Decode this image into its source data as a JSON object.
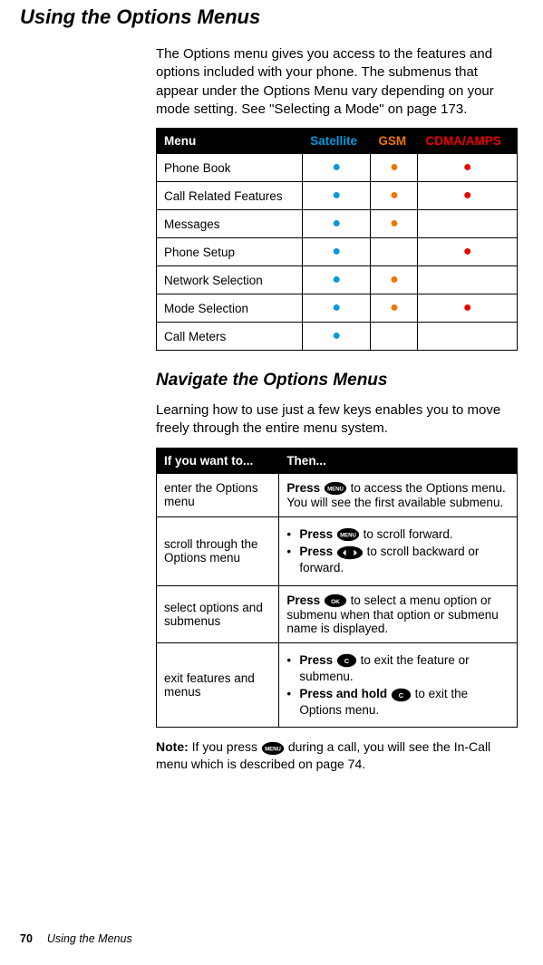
{
  "title": "Using the Options Menus",
  "intro": "The Options menu gives you access to the features and options included with your phone. The submenus that appear under the Options Menu vary depending on your mode setting. See \"Selecting a Mode\" on page 173.",
  "modes_table": {
    "head_menu": "Menu",
    "head_satellite": "Satellite",
    "head_gsm": "GSM",
    "head_cdma": "CDMA/AMPS",
    "rows": [
      {
        "label": "Phone Book",
        "sat": true,
        "gsm": true,
        "cdma": true
      },
      {
        "label": "Call Related Features",
        "sat": true,
        "gsm": true,
        "cdma": true
      },
      {
        "label": "Messages",
        "sat": true,
        "gsm": true,
        "cdma": false
      },
      {
        "label": "Phone Setup",
        "sat": true,
        "gsm": false,
        "cdma": true
      },
      {
        "label": "Network Selection",
        "sat": true,
        "gsm": true,
        "cdma": false
      },
      {
        "label": "Mode Selection",
        "sat": true,
        "gsm": true,
        "cdma": true
      },
      {
        "label": "Call Meters",
        "sat": true,
        "gsm": false,
        "cdma": false
      }
    ]
  },
  "navigate_heading": "Navigate the Options Menus",
  "navigate_para": "Learning how to use just a few keys enables you to move freely through the entire menu system.",
  "keys_table": {
    "head_if": "If you want to...",
    "head_then": "Then...",
    "rows": {
      "enter": {
        "if": "enter the Options menu",
        "then_pre": "Press ",
        "then_post": " to access the Options menu. You will see the first available submenu."
      },
      "scroll": {
        "if": "scroll through the Options menu",
        "b1_pre": "Press ",
        "b1_post": " to scroll forward.",
        "b2_pre": "Press ",
        "b2_post": " to scroll backward or forward."
      },
      "select": {
        "if": "select options and submenus",
        "then_pre": "Press ",
        "then_post": " to select a menu option or submenu when that option or submenu name is displayed."
      },
      "exit": {
        "if": "exit features and menus",
        "b1_pre": "Press ",
        "b1_post": " to exit the feature or submenu.",
        "b2_pre": "Press and hold ",
        "b2_post": " to exit the Options menu."
      }
    }
  },
  "note_bold": "Note:",
  "note_pre": " If you press ",
  "note_mid": " during",
  "note_post": " a call, you will see the In-Call menu which is described on page 74.",
  "footer_page": "70",
  "footer_label": "Using the Menus"
}
